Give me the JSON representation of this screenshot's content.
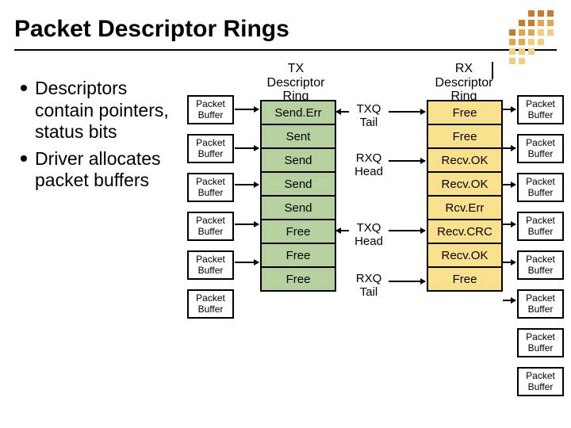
{
  "title": "Packet Descriptor Rings",
  "bullets": [
    "Descriptors contain pointers, status bits",
    "Driver allocates packet buffers"
  ],
  "packet_buffer_label": "Packet Buffer",
  "tx_header": "TX Descriptor Ring",
  "rx_header": "RX Descriptor Ring",
  "tx_cells": [
    "Send.Err",
    "Sent",
    "Send",
    "Send",
    "Send",
    "Free",
    "Free",
    "Free"
  ],
  "rx_cells": [
    "Free",
    "Free",
    "Recv.OK",
    "Recv.OK",
    "Rcv.Err",
    "Recv.CRC",
    "Recv.OK",
    "Free"
  ],
  "pointers": {
    "txq_tail": "TXQ Tail",
    "rxq_head": "RXQ Head",
    "txq_head": "TXQ Head",
    "rxq_tail": "RXQ Tail"
  },
  "left_buffer_count": 6,
  "right_buffer_count": 8
}
